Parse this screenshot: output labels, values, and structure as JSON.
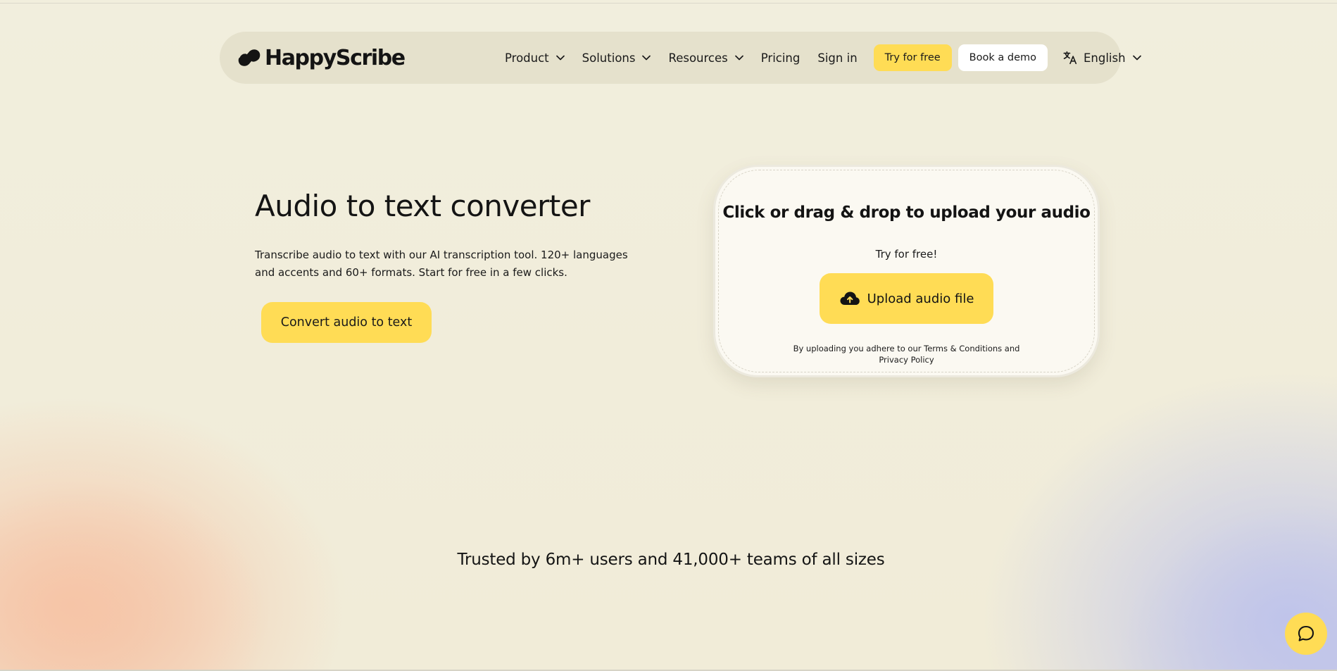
{
  "brand": {
    "name": "HappyScribe",
    "accent_color": "#ffdc55",
    "background_color": "#f1edda"
  },
  "nav": {
    "items": [
      {
        "label": "Product",
        "has_dropdown": true
      },
      {
        "label": "Solutions",
        "has_dropdown": true
      },
      {
        "label": "Resources",
        "has_dropdown": true
      },
      {
        "label": "Pricing",
        "has_dropdown": false
      },
      {
        "label": "Sign in",
        "has_dropdown": false
      }
    ],
    "try_label": "Try for free",
    "demo_label": "Book a demo",
    "language": {
      "label": "English",
      "icon": "translate-icon"
    }
  },
  "hero": {
    "title": "Audio to text converter",
    "description": "Transcribe audio to text with our AI transcription tool. 120+ languages and accents and 60+ formats. Start for free in a few clicks.",
    "cta_label": "Convert audio to text"
  },
  "upload": {
    "title": "Click or drag & drop to upload your audio",
    "try_text": "Try for free!",
    "button_label": "Upload audio file",
    "button_icon": "cloud-upload-icon",
    "terms_line1": "By uploading you adhere to our Terms & Conditions and",
    "terms_line2": "Privacy Policy"
  },
  "trusted": {
    "text": "Trusted by 6m+ users and 41,000+ teams of all sizes"
  },
  "chat": {
    "icon": "chat-bubble-icon"
  }
}
